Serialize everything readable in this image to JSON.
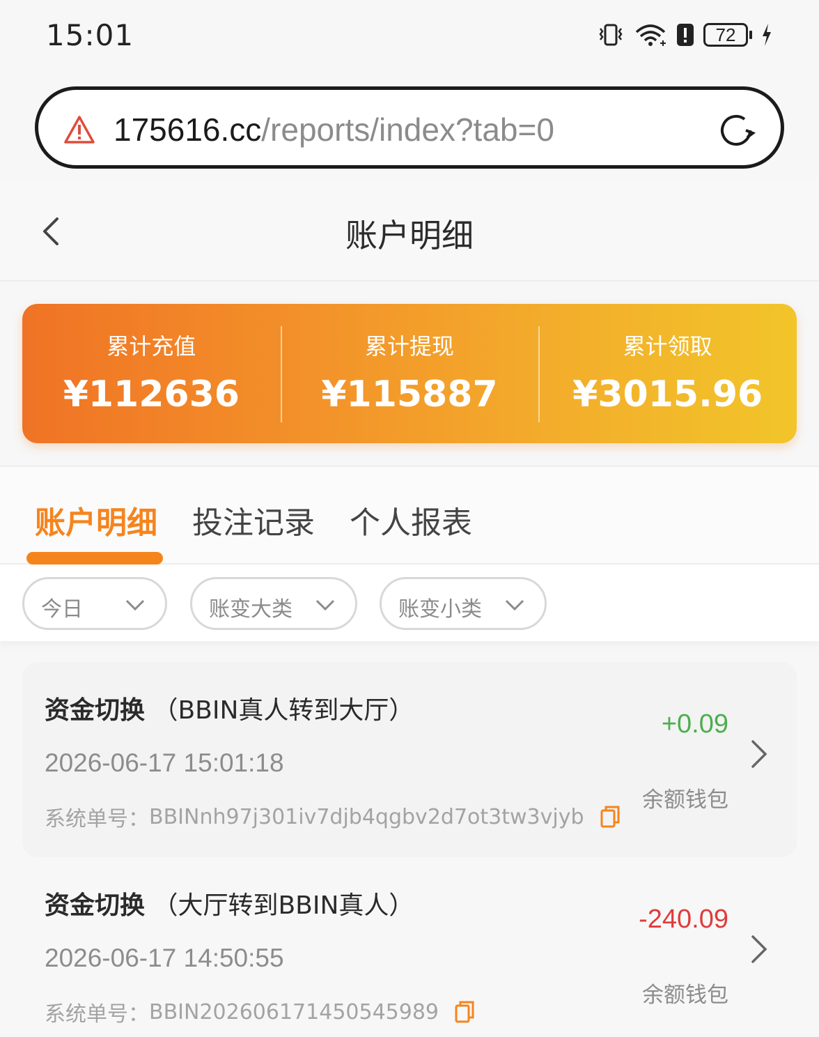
{
  "status_bar": {
    "time": "15:01",
    "battery": "72",
    "icons": [
      "vibrate-icon",
      "wifi-icon",
      "alert-icon",
      "battery-icon",
      "charging-icon"
    ]
  },
  "url_bar": {
    "domain": "175616.cc",
    "path": "/reports/index?tab=0",
    "warning_icon": "warning-triangle-icon",
    "reload_icon": "reload-icon"
  },
  "header": {
    "title": "账户明细",
    "back_icon": "chevron-left-icon"
  },
  "summary": {
    "items": [
      {
        "label": "累计充值",
        "value": "¥112636"
      },
      {
        "label": "累计提现",
        "value": "¥115887"
      },
      {
        "label": "累计领取",
        "value": "¥3015.96"
      }
    ],
    "gradient_start": "#f07325",
    "gradient_end": "#f2c52a"
  },
  "tabs": [
    {
      "label": "账户明细",
      "active": true
    },
    {
      "label": "投注记录",
      "active": false
    },
    {
      "label": "个人报表",
      "active": false
    }
  ],
  "filters": [
    {
      "label": "今日"
    },
    {
      "label": "账变大类"
    },
    {
      "label": "账变小类"
    }
  ],
  "records": [
    {
      "title_main": "资金切换",
      "title_sub": "（BBIN真人转到大厅）",
      "time": "2026-06-17 15:01:18",
      "order_label": "系统单号：",
      "order_no": "BBINnh97j301iv7djb4qgbv2d7ot3tw3vjyb",
      "amount": "+0.09",
      "wallet": "余额钱包"
    },
    {
      "title_main": "资金切换",
      "title_sub": "（大厅转到BBIN真人）",
      "time": "2026-06-17 14:50:55",
      "order_label": "系统单号：",
      "order_no": "BBIN202606171450545989",
      "amount": "-240.09",
      "wallet": "余额钱包"
    }
  ],
  "colors": {
    "accent": "#f6841d",
    "positive": "#4bae4f",
    "negative": "#e03b3b"
  }
}
